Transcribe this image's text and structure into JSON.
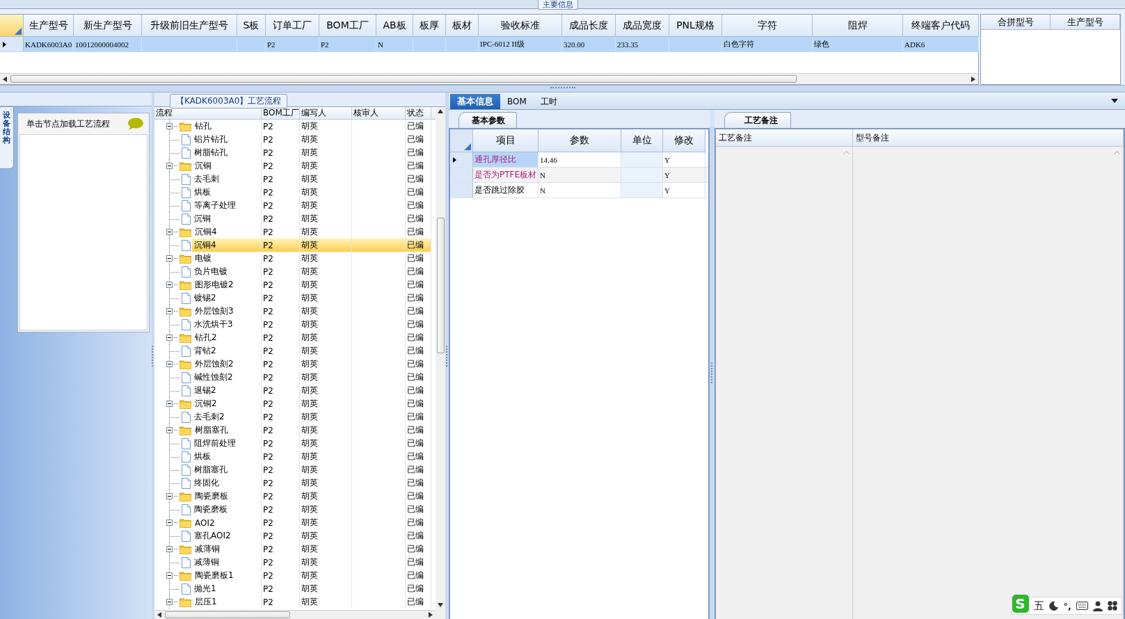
{
  "main_info": {
    "title": "主要信息",
    "table": {
      "columns": [
        "生产型号",
        "新生产型号",
        "升级前旧生产型号",
        "S板",
        "订单工厂",
        "BOM工厂",
        "AB板",
        "板厚",
        "板材",
        "验收标准",
        "成品长度",
        "成品宽度",
        "PNL规格",
        "字符",
        "阻焊",
        "终端客户代码"
      ],
      "rows": [
        {
          "selected": true,
          "cells": [
            "KADK6003A0",
            "10012000004002",
            null,
            null,
            "P2",
            "P2",
            "N",
            null,
            null,
            "IPC-6012 II级",
            "320.00",
            "233.35",
            null,
            "白色字符",
            "绿色",
            "ADK6"
          ]
        }
      ]
    },
    "merge_table": {
      "columns": [
        "合拼型号",
        "生产型号"
      ]
    }
  },
  "process_panel": {
    "side_tab": "设备结构",
    "hint": "单击节点加载工艺流程",
    "title": "【KADK6003A0】工艺流程",
    "tree": {
      "columns": [
        "流程",
        "BOM工厂",
        "编写人",
        "核审人",
        "状态"
      ],
      "rows": [
        {
          "label": "钻孔",
          "bom": "P2",
          "writer": "胡英",
          "status": "已编",
          "expanded": true,
          "selected": false,
          "children": [
            {
              "label": "铝片钻孔",
              "bom": "P2",
              "writer": "胡英",
              "status": "已编",
              "selected": false
            },
            {
              "label": "树脂钻孔",
              "bom": "P2",
              "writer": "胡英",
              "status": "已编",
              "selected": false
            }
          ]
        },
        {
          "label": "沉铜",
          "bom": "P2",
          "writer": "胡英",
          "status": "已编",
          "expanded": true,
          "selected": false,
          "children": [
            {
              "label": "去毛刺",
              "bom": "P2",
              "writer": "胡英",
              "status": "已编",
              "selected": false
            },
            {
              "label": "烘板",
              "bom": "P2",
              "writer": "胡英",
              "status": "已编",
              "selected": false
            },
            {
              "label": "等离子处理",
              "bom": "P2",
              "writer": "胡英",
              "status": "已编",
              "selected": false
            },
            {
              "label": "沉铜",
              "bom": "P2",
              "writer": "胡英",
              "status": "已编",
              "selected": false
            }
          ]
        },
        {
          "label": "沉铜4",
          "bom": "P2",
          "writer": "胡英",
          "status": "已编",
          "expanded": true,
          "selected": false,
          "children": [
            {
              "label": "沉铜4",
              "bom": "P2",
              "writer": "胡英",
              "status": "已编",
              "selected": true
            }
          ]
        },
        {
          "label": "电镀",
          "bom": "P2",
          "writer": "胡英",
          "status": "已编",
          "expanded": true,
          "selected": false,
          "children": [
            {
              "label": "负片电镀",
              "bom": "P2",
              "writer": "胡英",
              "status": "已编",
              "selected": false
            }
          ]
        },
        {
          "label": "图形电镀2",
          "bom": "P2",
          "writer": "胡英",
          "status": "已编",
          "expanded": true,
          "selected": false,
          "children": [
            {
              "label": "镀锡2",
              "bom": "P2",
              "writer": "胡英",
              "status": "已编",
              "selected": false
            }
          ]
        },
        {
          "label": "外层蚀刻3",
          "bom": "P2",
          "writer": "胡英",
          "status": "已编",
          "expanded": true,
          "selected": false,
          "children": [
            {
              "label": "水洗烘干3",
              "bom": "P2",
              "writer": "胡英",
              "status": "已编",
              "selected": false
            }
          ]
        },
        {
          "label": "钻孔2",
          "bom": "P2",
          "writer": "胡英",
          "status": "已编",
          "expanded": true,
          "selected": false,
          "children": [
            {
              "label": "背钻2",
              "bom": "P2",
              "writer": "胡英",
              "status": "已编",
              "selected": false
            }
          ]
        },
        {
          "label": "外层蚀刻2",
          "bom": "P2",
          "writer": "胡英",
          "status": "已编",
          "expanded": true,
          "selected": false,
          "children": [
            {
              "label": "碱性蚀刻2",
              "bom": "P2",
              "writer": "胡英",
              "status": "已编",
              "selected": false
            },
            {
              "label": "退锡2",
              "bom": "P2",
              "writer": "胡英",
              "status": "已编",
              "selected": false
            }
          ]
        },
        {
          "label": "沉铜2",
          "bom": "P2",
          "writer": "胡英",
          "status": "已编",
          "expanded": true,
          "selected": false,
          "children": [
            {
              "label": "去毛刺2",
              "bom": "P2",
              "writer": "胡英",
              "status": "已编",
              "selected": false
            }
          ]
        },
        {
          "label": "树脂塞孔",
          "bom": "P2",
          "writer": "胡英",
          "status": "已编",
          "expanded": true,
          "selected": false,
          "children": [
            {
              "label": "阻焊前处理",
              "bom": "P2",
              "writer": "胡英",
              "status": "已编",
              "selected": false
            },
            {
              "label": "烘板",
              "bom": "P2",
              "writer": "胡英",
              "status": "已编",
              "selected": false
            },
            {
              "label": "树脂塞孔",
              "bom": "P2",
              "writer": "胡英",
              "status": "已编",
              "selected": false
            },
            {
              "label": "终固化",
              "bom": "P2",
              "writer": "胡英",
              "status": "已编",
              "selected": false
            }
          ]
        },
        {
          "label": "陶瓷磨板",
          "bom": "P2",
          "writer": "胡英",
          "status": "已编",
          "expanded": true,
          "selected": false,
          "children": [
            {
              "label": "陶瓷磨板",
              "bom": "P2",
              "writer": "胡英",
              "status": "已编",
              "selected": false
            }
          ]
        },
        {
          "label": "AOI2",
          "bom": "P2",
          "writer": "胡英",
          "status": "已编",
          "expanded": true,
          "selected": false,
          "children": [
            {
              "label": "塞孔AOI2",
              "bom": "P2",
              "writer": "胡英",
              "status": "已编",
              "selected": false
            }
          ]
        },
        {
          "label": "减薄铜",
          "bom": "P2",
          "writer": "胡英",
          "status": "已编",
          "expanded": true,
          "selected": false,
          "children": [
            {
              "label": "减薄铜",
              "bom": "P2",
              "writer": "胡英",
              "status": "已编",
              "selected": false
            }
          ]
        },
        {
          "label": "陶瓷磨板1",
          "bom": "P2",
          "writer": "胡英",
          "status": "已编",
          "expanded": true,
          "selected": false,
          "children": [
            {
              "label": "抛光1",
              "bom": "P2",
              "writer": "胡英",
              "status": "已编",
              "selected": false
            }
          ]
        },
        {
          "label": "层压1",
          "bom": "P2",
          "writer": "胡英",
          "status": "已编",
          "expanded": true,
          "selected": false
        }
      ]
    }
  },
  "detail": {
    "tabs": [
      {
        "label": "基本信息",
        "selected": true
      },
      {
        "label": "BOM",
        "selected": false
      },
      {
        "label": "工时",
        "selected": false
      }
    ],
    "params": {
      "tab": "基本参数",
      "columns": [
        "项目",
        "参数",
        "单位",
        "修改"
      ],
      "rows": [
        {
          "item": "通孔厚径比",
          "flagged": true,
          "selected": true,
          "value": "14.46",
          "modified": "Y"
        },
        {
          "item": "是否为PTFE板材",
          "flagged": true,
          "selected": false,
          "value": "N",
          "modified": "Y"
        },
        {
          "item": "是否跳过除胶",
          "flagged": false,
          "selected": false,
          "value": "N",
          "modified": "Y"
        }
      ]
    },
    "notes": {
      "tab": "工艺备注",
      "columns": [
        "工艺备注",
        "型号备注"
      ]
    }
  },
  "ime": {
    "logo": "S",
    "mode": "五",
    "punctuation": "°,"
  }
}
